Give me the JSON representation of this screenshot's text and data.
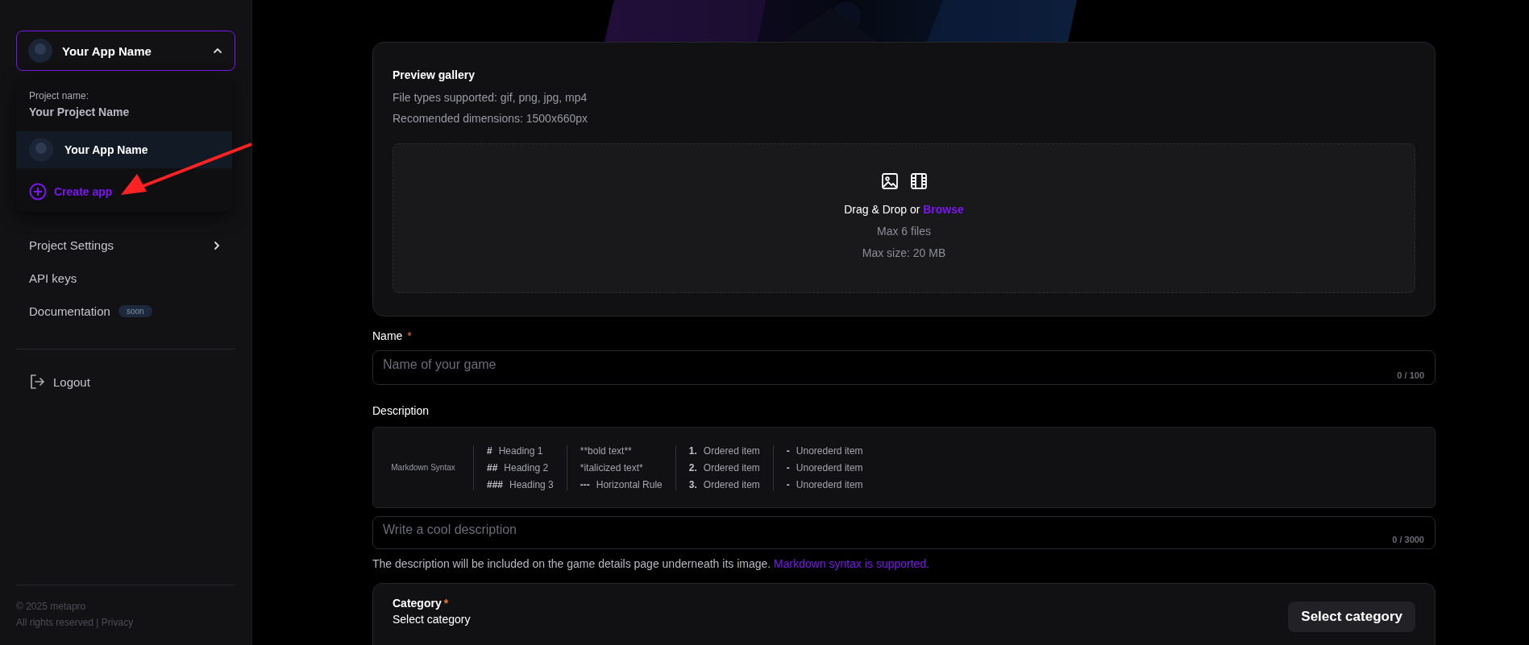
{
  "sidebar": {
    "app_switcher": {
      "app_name": "Your App Name",
      "expanded": true
    },
    "menu": {
      "project_label": "Project name:",
      "project_name": "Your Project Name",
      "apps": [
        {
          "name": "Your App Name",
          "selected": true
        }
      ],
      "create_label": "Create app"
    },
    "nav": [
      {
        "label": "Project Settings",
        "chevron": true
      },
      {
        "label": "API keys",
        "chevron": false
      },
      {
        "label": "Documentation",
        "chevron": false,
        "badge": "soon"
      }
    ],
    "logout": "Logout",
    "footer": {
      "copyright": "© 2025 metapro",
      "rights": "All rights reserved | ",
      "privacy": "Privacy"
    }
  },
  "gallery": {
    "title": "Preview gallery",
    "file_types": "File types supported: gif, png, jpg, mp4",
    "dimensions": "Recomended dimensions: 1500x660px",
    "drop_text": "Drag & Drop or ",
    "browse": "Browse",
    "max_files": "Max 6 files",
    "max_size": "Max size: 20 MB"
  },
  "name_field": {
    "label": "Name",
    "required_mark": "*",
    "placeholder": "Name of your game",
    "counter": "0 / 100"
  },
  "description": {
    "label": "Description",
    "markdown": {
      "title": "Markdown Syntax",
      "columns": [
        [
          {
            "mark": "#",
            "text": "Heading 1"
          },
          {
            "mark": "##",
            "text": "Heading 2"
          },
          {
            "mark": "###",
            "text": "Heading 3"
          }
        ],
        [
          {
            "text": "**bold text**"
          },
          {
            "text": "*italicized text*"
          },
          {
            "mark": "---",
            "text": "Horizontal Rule"
          }
        ],
        [
          {
            "mark": "1.",
            "text": "Ordered item"
          },
          {
            "mark": "2.",
            "text": "Ordered item"
          },
          {
            "mark": "3.",
            "text": "Ordered item"
          }
        ],
        [
          {
            "mark": "-",
            "text": "Unorederd item"
          },
          {
            "mark": "-",
            "text": "Unorederd item"
          },
          {
            "mark": "-",
            "text": "Unorederd item"
          }
        ]
      ]
    },
    "placeholder": "Write a cool description",
    "counter": "0 / 3000",
    "help": "The description will be included on the game details page underneath its image. ",
    "help_link": "Markdown syntax is supported."
  },
  "category": {
    "label": "Category",
    "required_mark": "*",
    "hint": "Select category",
    "button": "Select category"
  }
}
